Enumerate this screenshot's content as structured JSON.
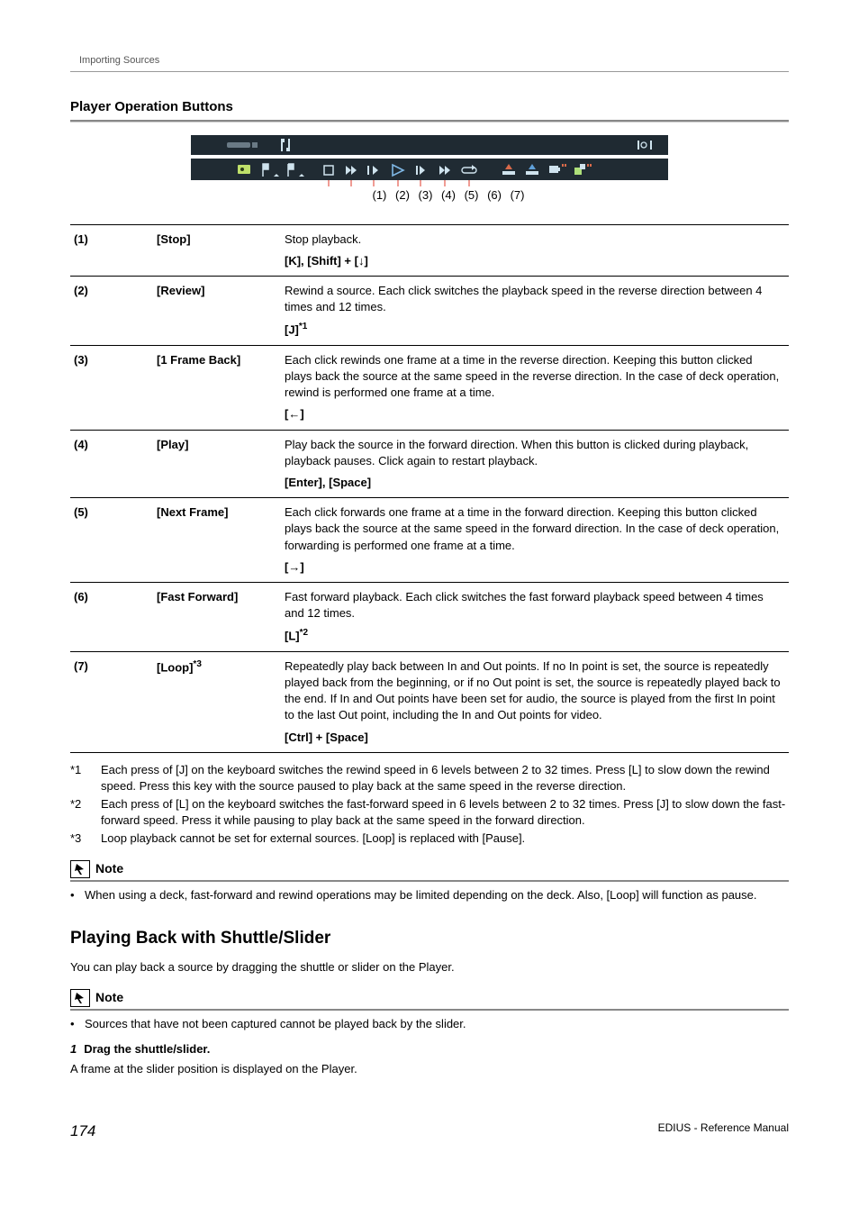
{
  "header": {
    "breadcrumb": "Importing Sources"
  },
  "section1": {
    "title": "Player Operation Buttons",
    "callouts": [
      "(1)",
      "(2)",
      "(3)",
      "(4)",
      "(5)",
      "(6)",
      "(7)"
    ]
  },
  "table": [
    {
      "num": "(1)",
      "name": "[Stop]",
      "desc": "Stop playback.",
      "shortcut": "[K], [Shift] + [↓]"
    },
    {
      "num": "(2)",
      "name": "[Review]",
      "desc": "Rewind a source. Each click switches the playback speed in the reverse direction between 4 times and 12 times.",
      "shortcut": "[J]",
      "shortcut_sup": "*1"
    },
    {
      "num": "(3)",
      "name": "[1 Frame Back]",
      "desc": "Each click rewinds one frame at a time in the reverse direction. Keeping this button clicked plays back the source at the same speed in the reverse direction. In the case of deck operation, rewind is performed one frame at a time.",
      "shortcut": "[←]"
    },
    {
      "num": "(4)",
      "name": "[Play]",
      "desc": "Play back the source in the forward direction. When this button is clicked during playback, playback pauses. Click again to restart playback.",
      "shortcut": "[Enter], [Space]"
    },
    {
      "num": "(5)",
      "name": "[Next Frame]",
      "desc": "Each click forwards one frame at a time in the forward direction. Keeping this button clicked plays back the source at the same speed in the forward direction. In the case of deck operation, forwarding is performed one frame at a time.",
      "shortcut": "[→]"
    },
    {
      "num": "(6)",
      "name": "[Fast Forward]",
      "desc": "Fast forward playback. Each click switches the fast forward playback speed between 4 times and 12 times.",
      "shortcut": "[L]",
      "shortcut_sup": "*2"
    },
    {
      "num": "(7)",
      "name": "[Loop]",
      "name_sup": "*3",
      "desc": "Repeatedly play back between In and Out points. If no In point is set, the source is repeatedly played back from the beginning, or if no Out point is set, the source is repeatedly played back to the end. If In and Out points have been set for audio, the source is played from the first In point to the last Out point, including the In and Out points for video.",
      "shortcut": "[Ctrl] + [Space]"
    }
  ],
  "footnotes": [
    {
      "label": "*1",
      "text": "Each press of [J] on the keyboard switches the rewind speed in 6 levels between 2 to 32 times. Press [L] to slow down the rewind speed. Press this key with the source paused to play back at the same speed in the reverse direction."
    },
    {
      "label": "*2",
      "text": "Each press of [L] on the keyboard switches the fast-forward speed in 6 levels between 2 to 32 times. Press [J] to slow down the fast-forward speed. Press it while pausing to play back at the same speed in the forward direction."
    },
    {
      "label": "*3",
      "text": "Loop playback cannot be set for external sources. [Loop] is replaced with [Pause]."
    }
  ],
  "note1": {
    "label": "Note",
    "text": "When using a deck, fast-forward and rewind operations may be limited depending on the deck. Also, [Loop] will function as pause."
  },
  "section2": {
    "title": "Playing Back with Shuttle/Slider",
    "intro": "You can play back a source by dragging the shuttle or slider on the Player."
  },
  "note2": {
    "label": "Note",
    "text": "Sources that have not been captured cannot be played back by the slider."
  },
  "step": {
    "num": "1",
    "text": "Drag the shuttle/slider.",
    "after": "A frame at the slider position is displayed on the Player."
  },
  "footer": {
    "page": "174",
    "doc": "EDIUS - Reference Manual"
  }
}
